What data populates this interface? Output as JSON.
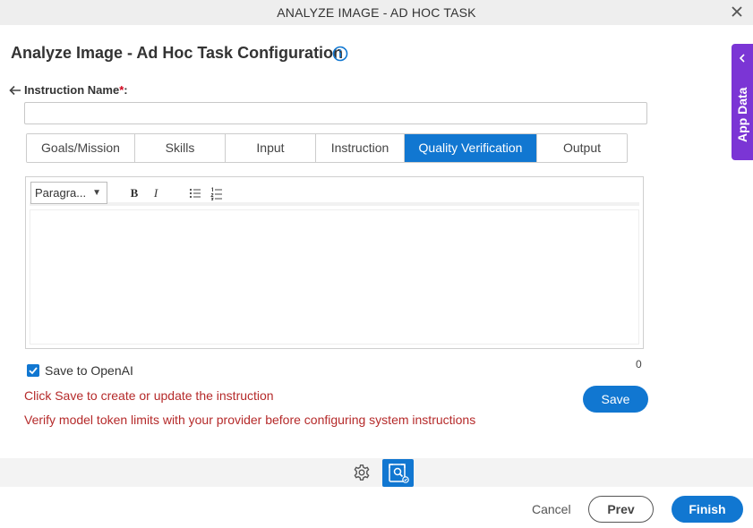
{
  "window": {
    "title": "ANALYZE IMAGE - AD HOC TASK",
    "close_icon": "close-icon"
  },
  "header": {
    "title": "Analyze Image - Ad Hoc Task Configuration",
    "info_icon": "info-icon"
  },
  "form": {
    "instruction_label": "Instruction Name",
    "required_mark": "*",
    "label_suffix": ":",
    "instruction_value": "",
    "instruction_placeholder": ""
  },
  "tabs": [
    {
      "label": "Goals/Mission",
      "active": false
    },
    {
      "label": "Skills",
      "active": false
    },
    {
      "label": "Input",
      "active": false
    },
    {
      "label": "Instruction",
      "active": false
    },
    {
      "label": "Quality Verification",
      "active": true
    },
    {
      "label": "Output",
      "active": false
    }
  ],
  "editor": {
    "format_value": "Paragra...",
    "bold_label": "B",
    "italic_label": "I",
    "content": "",
    "char_count": "0"
  },
  "options": {
    "save_to_openai_label": "Save to OpenAI",
    "save_to_openai_checked": true
  },
  "messages": {
    "line1": "Click Save to create or update the instruction",
    "line2": "Verify model token limits with your provider before configuring system instructions"
  },
  "buttons": {
    "save": "Save",
    "cancel": "Cancel",
    "prev": "Prev",
    "finish": "Finish"
  },
  "side_panel": {
    "label": "App Data"
  },
  "colors": {
    "primary": "#1177d1",
    "side_panel": "#7b35d5",
    "error_text": "#b52a2a",
    "title_bar": "#eeeeee"
  }
}
